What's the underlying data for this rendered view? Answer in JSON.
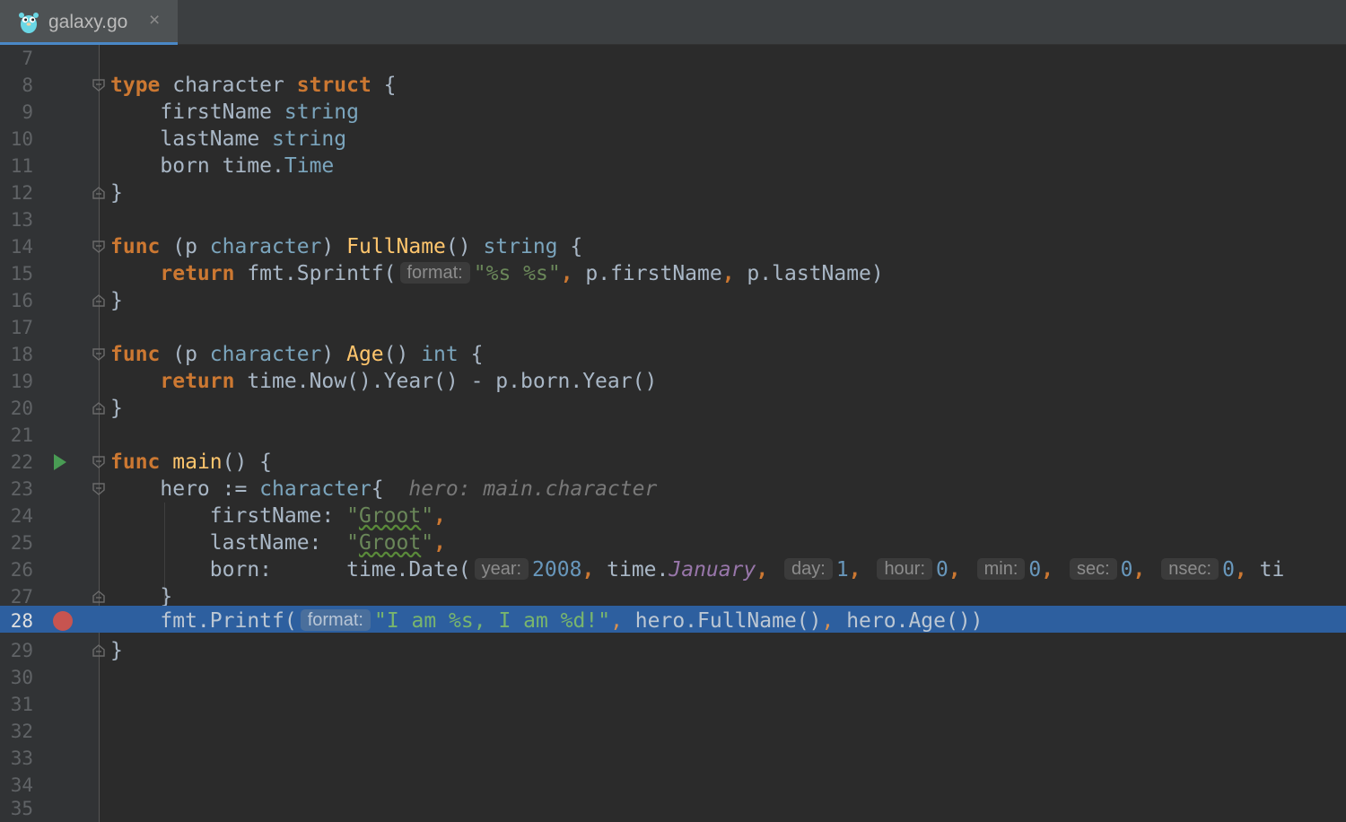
{
  "tab": {
    "file_name": "galaxy.go",
    "close_glyph": "×"
  },
  "editor": {
    "current_line": 28,
    "breakpoint_line": 28,
    "run_marker_line": 22,
    "lines": [
      {
        "num": "7"
      },
      {
        "num": "8"
      },
      {
        "num": "9"
      },
      {
        "num": "10"
      },
      {
        "num": "11"
      },
      {
        "num": "12"
      },
      {
        "num": "13"
      },
      {
        "num": "14"
      },
      {
        "num": "15"
      },
      {
        "num": "16"
      },
      {
        "num": "17"
      },
      {
        "num": "18"
      },
      {
        "num": "19"
      },
      {
        "num": "20"
      },
      {
        "num": "21"
      },
      {
        "num": "22"
      },
      {
        "num": "23"
      },
      {
        "num": "24"
      },
      {
        "num": "25"
      },
      {
        "num": "26"
      },
      {
        "num": "27"
      },
      {
        "num": "28"
      },
      {
        "num": "29"
      },
      {
        "num": "30"
      },
      {
        "num": "31"
      },
      {
        "num": "32"
      },
      {
        "num": "33"
      },
      {
        "num": "34"
      },
      {
        "num": "35"
      }
    ]
  },
  "code": {
    "l8": {
      "kw1": "type",
      "name": " character ",
      "kw2": "struct",
      "brace": " {"
    },
    "l9": {
      "field": "    firstName ",
      "type": "string"
    },
    "l10": {
      "field": "    lastName ",
      "type": "string"
    },
    "l11": {
      "field": "    born time.",
      "type": "Time"
    },
    "l12": {
      "text": "}"
    },
    "l14": {
      "kw": "func",
      "p1": " (p ",
      "recv": "character",
      "p2": ") ",
      "fn": "FullName",
      "p3": "() ",
      "ret": "string",
      "p4": " {"
    },
    "l15": {
      "indent": "    ",
      "kw": "return",
      "call": " fmt.Sprintf(",
      "hint": "format:",
      "str": "\"%s %s\"",
      "comma": ",",
      "args1": " p.firstName",
      "comma2": ",",
      "args2": " p.lastName)"
    },
    "l16": {
      "text": "}"
    },
    "l18": {
      "kw": "func",
      "p1": " (p ",
      "recv": "character",
      "p2": ") ",
      "fn": "Age",
      "p3": "() ",
      "ret": "int",
      "p4": " {"
    },
    "l19": {
      "indent": "    ",
      "kw": "return",
      "rest": " time.Now().Year() - p.born.Year()"
    },
    "l20": {
      "text": "}"
    },
    "l22": {
      "kw": "func",
      "sp": " ",
      "fn": "main",
      "rest": "() {"
    },
    "l23": {
      "indent": "    hero := ",
      "type": "character",
      "brace": "{",
      "inlay": "  hero: main.character"
    },
    "l24": {
      "field": "        firstName: ",
      "str_open": "\"",
      "str_word": "Groot",
      "str_close": "\"",
      "comma": ","
    },
    "l25": {
      "field": "        lastName:  ",
      "str_open": "\"",
      "str_word": "Groot",
      "str_close": "\"",
      "comma": ","
    },
    "l26": {
      "field": "        born:      time.Date(",
      "hint_year": "year:",
      "year": "2008",
      "c1": ",",
      "t": " time.",
      "month": "January",
      "c2": ",",
      "hint_day": "day:",
      "day": "1",
      "c3": ",",
      "hint_hour": "hour:",
      "hour": "0",
      "c4": ",",
      "hint_min": "min:",
      "min": "0",
      "c5": ",",
      "hint_sec": "sec:",
      "sec": "0",
      "c6": ",",
      "hint_nsec": "nsec:",
      "nsec": "0",
      "c7": ",",
      "tail": " ti"
    },
    "l27": {
      "text": "    }"
    },
    "l28": {
      "indent": "    fmt.Printf(",
      "hint": "format:",
      "str": "\"I am %s, I am %d!\"",
      "comma": ",",
      "rest": " hero.FullName()",
      "comma2": ",",
      "rest2": " hero.Age())"
    },
    "l29": {
      "text": "}"
    }
  },
  "colors": {
    "background": "#2b2b2b",
    "gutter": "#313335",
    "selection": "#2d5f9f",
    "keyword": "#cc7832",
    "string": "#6a8759",
    "function": "#ffc66d",
    "number": "#6897bb",
    "constant": "#9876aa",
    "breakpoint": "#c75450",
    "run_marker": "#499c54"
  },
  "icons": {
    "tab_icon": "gopher-icon",
    "run": "run-arrow-icon",
    "breakpoint": "breakpoint-icon",
    "fold": "fold-marker-icon"
  }
}
